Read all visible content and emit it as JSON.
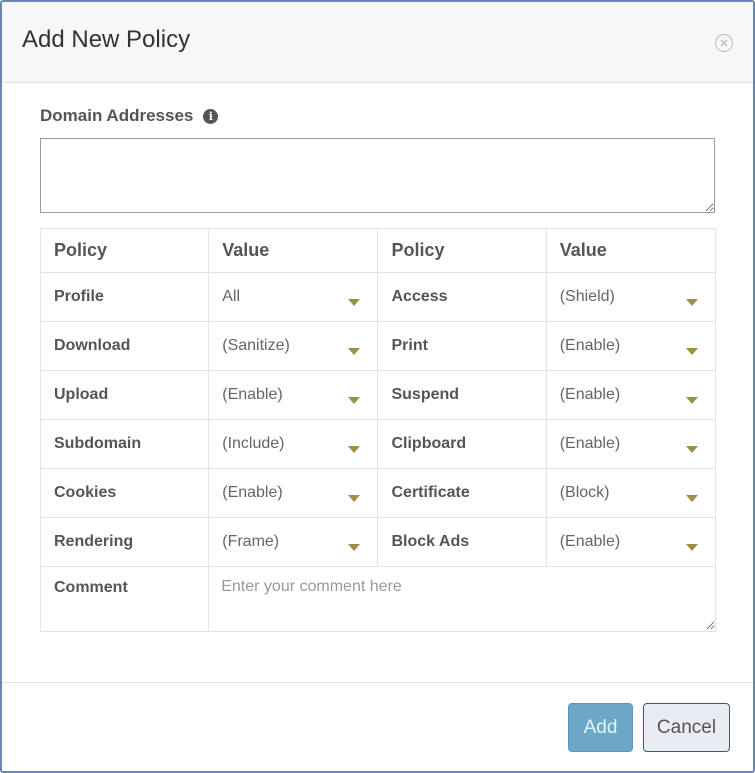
{
  "dialog": {
    "title": "Add New Policy"
  },
  "domain": {
    "label": "Domain Addresses",
    "value": ""
  },
  "table": {
    "headers": [
      "Policy",
      "Value",
      "Policy",
      "Value"
    ],
    "rows": [
      {
        "left_policy": "Profile",
        "left_value": "All",
        "right_policy": "Access",
        "right_value": "(Shield)"
      },
      {
        "left_policy": "Download",
        "left_value": "(Sanitize)",
        "right_policy": "Print",
        "right_value": "(Enable)"
      },
      {
        "left_policy": "Upload",
        "left_value": "(Enable)",
        "right_policy": "Suspend",
        "right_value": "(Enable)"
      },
      {
        "left_policy": "Subdomain",
        "left_value": "(Include)",
        "right_policy": "Clipboard",
        "right_value": "(Enable)"
      },
      {
        "left_policy": "Cookies",
        "left_value": "(Enable)",
        "right_policy": "Certificate",
        "right_value": "(Block)"
      },
      {
        "left_policy": "Rendering",
        "left_value": "(Frame)",
        "right_policy": "Block Ads",
        "right_value": "(Enable)"
      }
    ],
    "comment_label": "Comment",
    "comment_placeholder": "Enter your comment here"
  },
  "footer": {
    "add_label": "Add",
    "cancel_label": "Cancel"
  },
  "colors": {
    "add_button": "#6ba8c8",
    "cancel_border": "#2e5e79",
    "caret": "#9c8f47",
    "dialog_border": "#6b86b3"
  },
  "icons": [
    "close-icon",
    "info-icon",
    "chevron-down-icon"
  ]
}
